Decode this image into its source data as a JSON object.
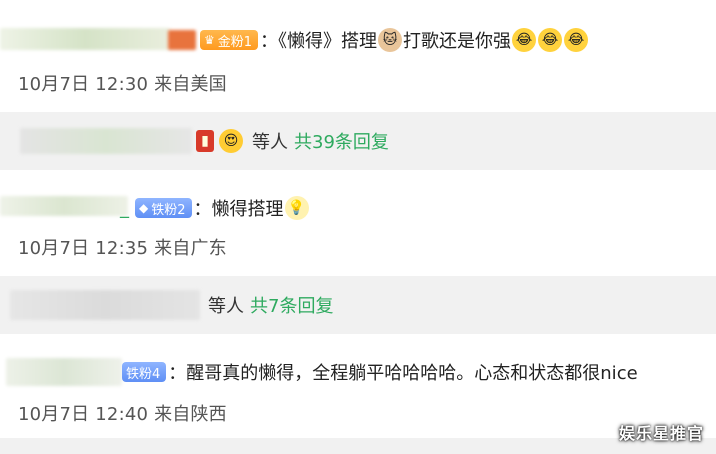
{
  "comments": [
    {
      "badge": {
        "label": "金粉1",
        "level": "gold"
      },
      "text": "：《懒得》搭理",
      "text_after_emoji": "打歌还是你强",
      "time": "10月7日 12:30",
      "location": "来自美国",
      "reply": {
        "who": "等人",
        "count": "共39条回复"
      }
    },
    {
      "badge": {
        "label": "铁粉2",
        "level": "iron"
      },
      "text": "：懒得搭理",
      "time": "10月7日 12:35",
      "location": "来自广东",
      "reply": {
        "who": "等人",
        "count": "共7条回复"
      }
    },
    {
      "badge": {
        "label": "铁粉4",
        "level": "iron"
      },
      "text": "：醒哥真的懒得，全程躺平哈哈哈哈。心态和状态都很nice",
      "time": "10月7日 12:40",
      "location": "来自陕西"
    }
  ],
  "watermark": "娱乐星推官",
  "colors": {
    "reply_green": "#2eaa5f",
    "reply_bg": "#f1f1f1",
    "gold_badge": "#ff9a1f",
    "iron_badge": "#5f8ff5"
  }
}
